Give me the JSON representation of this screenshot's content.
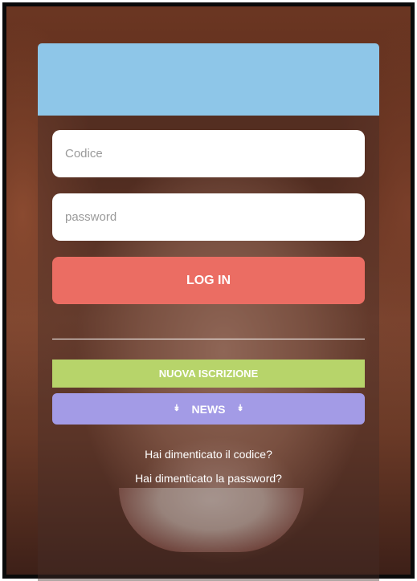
{
  "login": {
    "code_placeholder": "Codice",
    "password_placeholder": "password",
    "login_label": "LOG IN"
  },
  "actions": {
    "new_registration_label": "NUOVA ISCRIZIONE",
    "news_label": "NEWS"
  },
  "links": {
    "forgot_code": "Hai dimenticato il codice?",
    "forgot_password": "Hai dimenticato la password?"
  },
  "icons": {
    "news_left": "chevron-down-double-icon",
    "news_right": "chevron-down-double-icon"
  },
  "colors": {
    "header": "#8ec6e8",
    "login_button": "#eb6d63",
    "registration_button": "#b7d46a",
    "news_button": "#a39be6"
  }
}
